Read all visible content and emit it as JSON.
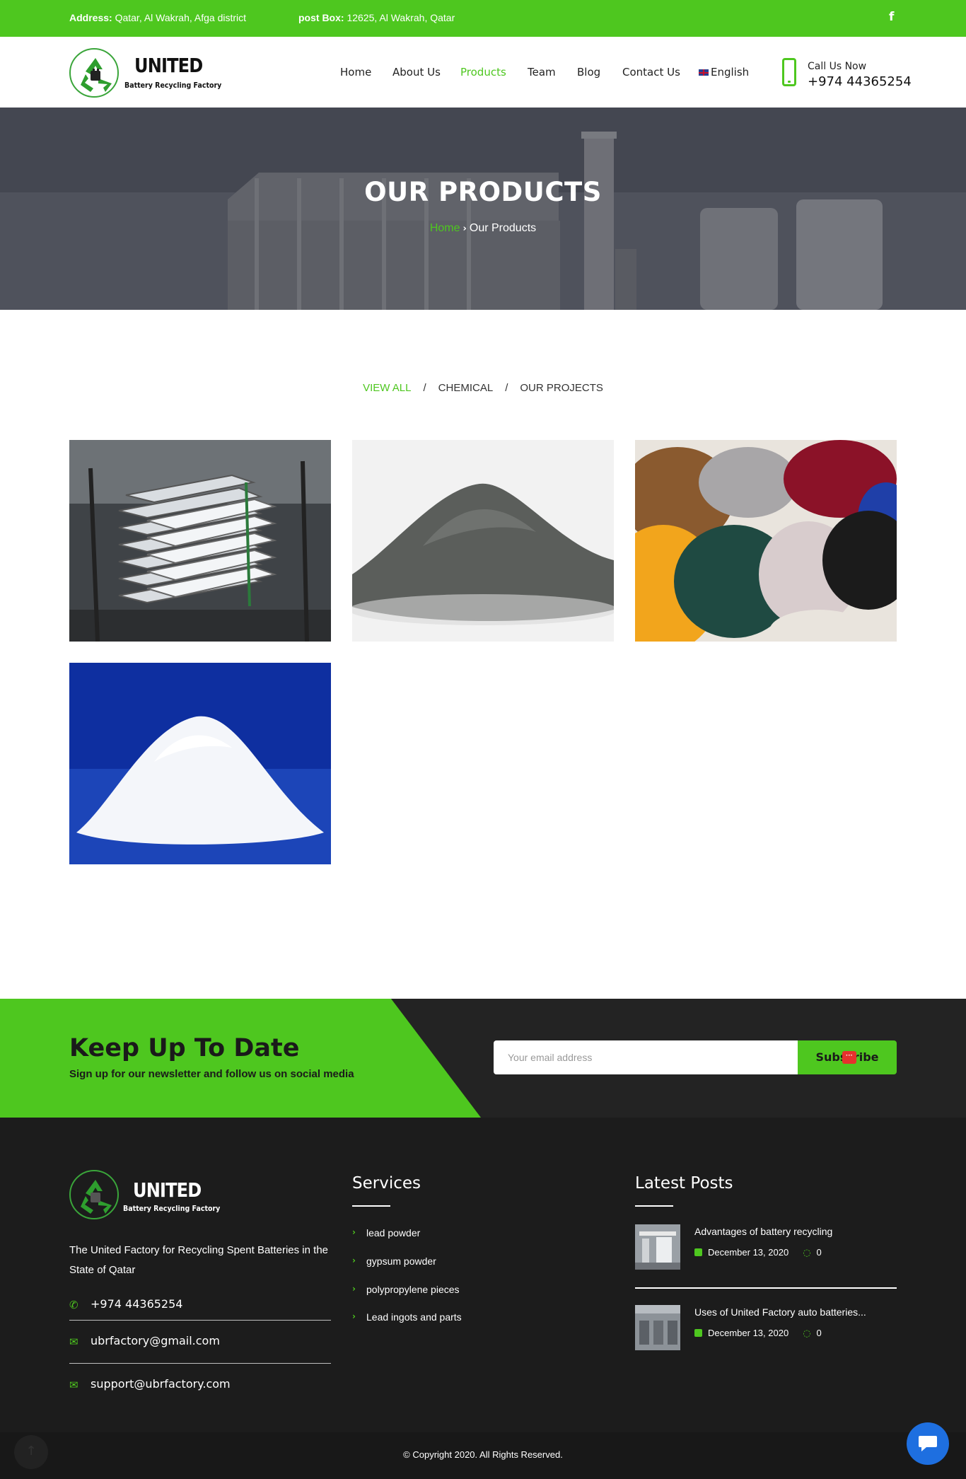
{
  "topbar": {
    "address_label": "Address:",
    "address_value": "Qatar, Al Wakrah, Afga district",
    "pobox_label": "post Box:",
    "pobox_value": "12625, Al Wakrah, Qatar",
    "facebook_glyph": "f"
  },
  "header": {
    "logo_name": "UNITED",
    "logo_tagline": "Battery Recycling Factory",
    "nav": [
      {
        "label": "Home",
        "active": false
      },
      {
        "label": "About Us",
        "active": false
      },
      {
        "label": "Products",
        "active": true
      },
      {
        "label": "Team",
        "active": false
      },
      {
        "label": "Blog",
        "active": false
      },
      {
        "label": "Contact Us",
        "active": false
      },
      {
        "label": "English",
        "active": false
      }
    ],
    "call_label": "Call Us Now",
    "call_number": "+974 44365254"
  },
  "hero": {
    "title": "OUR PRODUCTS",
    "breadcrumb_home": "Home",
    "breadcrumb_current": "Our Products"
  },
  "filters": {
    "items": [
      "VIEW ALL",
      "CHEMICAL",
      "OUR PROJECTS"
    ],
    "separator": "/",
    "active_index": 0
  },
  "products": [
    {
      "image": "lead-ingots"
    },
    {
      "image": "gray-powder-pile"
    },
    {
      "image": "plastic-pellets"
    },
    {
      "image": "white-powder-pile"
    }
  ],
  "newsletter": {
    "heading": "Keep Up To Date",
    "subheading": "Sign up for our newsletter and follow us on social media",
    "placeholder": "Your email address",
    "button_label": "Subscribe",
    "overlay_badge": "···"
  },
  "footer": {
    "logo_name": "UNITED",
    "logo_tagline": "Battery Recycling Factory",
    "description": "The United Factory for Recycling Spent Batteries in the State of Qatar",
    "phone": "+974 44365254",
    "email_1": "ubrfactory@gmail.com",
    "email_2": "support@ubrfactory.com",
    "services_heading": "Services",
    "services": [
      "lead powder",
      "gypsum powder",
      "polypropylene pieces",
      "Lead ingots and parts"
    ],
    "posts_heading": "Latest Posts",
    "posts": [
      {
        "title": "Advantages of battery recycling",
        "date": "December 13, 2020",
        "comments": "0"
      },
      {
        "title": "Uses of United Factory auto batteries...",
        "date": "December 13, 2020",
        "comments": "0"
      }
    ],
    "copyright": "© Copyright 2020. All Rights Reserved."
  },
  "colors": {
    "brand_green": "#4ec71f",
    "dark": "#1c1c1c",
    "chat_blue": "#1e6fe0"
  }
}
